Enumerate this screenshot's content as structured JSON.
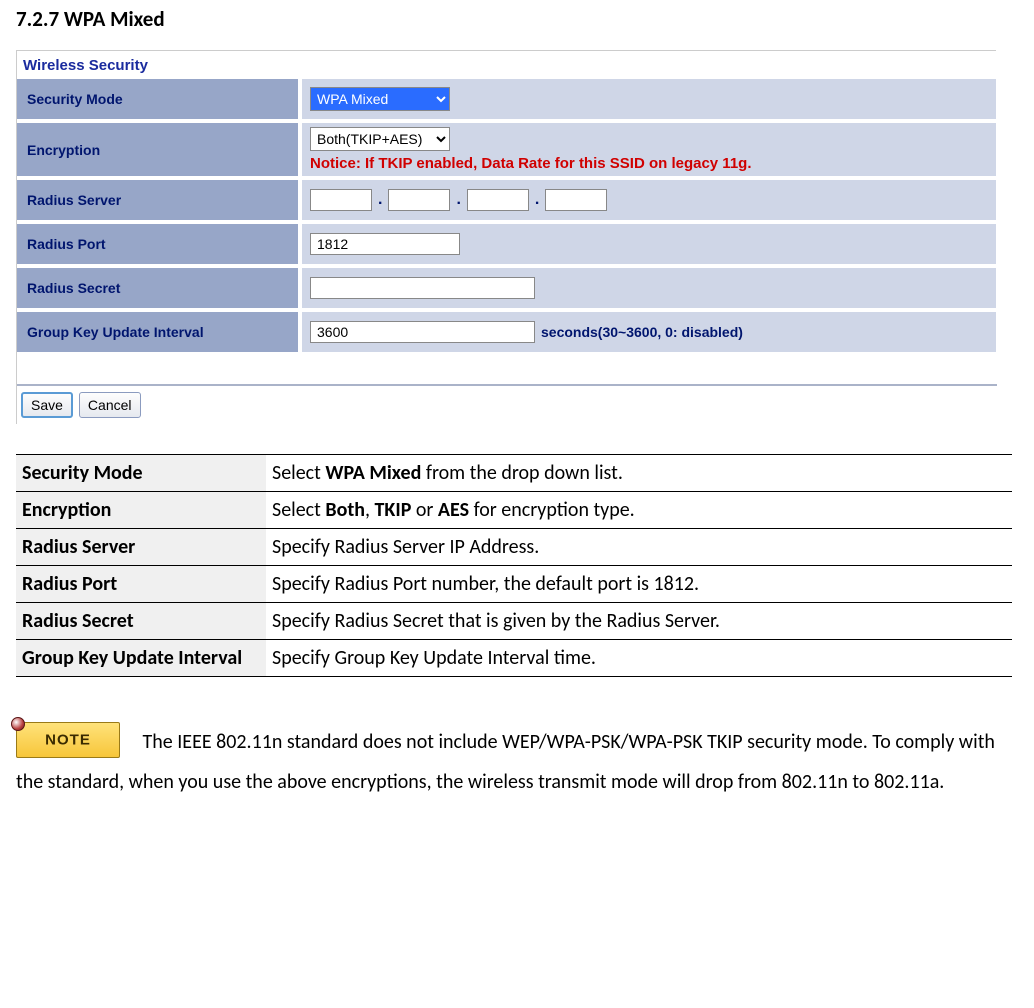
{
  "heading": "7.2.7 WPA Mixed",
  "panel": {
    "title": "Wireless Security",
    "rows": {
      "security_mode": {
        "label": "Security Mode",
        "value": "WPA Mixed"
      },
      "encryption": {
        "label": "Encryption",
        "value": "Both(TKIP+AES)",
        "warning": "Notice: If TKIP enabled, Data Rate for this SSID on legacy 11g."
      },
      "radius_server": {
        "label": "Radius Server",
        "dot": "."
      },
      "radius_port": {
        "label": "Radius Port",
        "value": "1812"
      },
      "radius_secret": {
        "label": "Radius Secret",
        "value": ""
      },
      "group_key": {
        "label": "Group Key Update Interval",
        "value": "3600",
        "suffix": "seconds(30~3600, 0: disabled)"
      }
    },
    "buttons": {
      "save": "Save",
      "cancel": "Cancel"
    }
  },
  "definitions": [
    {
      "term": "Security Mode",
      "desc_pre": "Select ",
      "desc_bold1": "WPA Mixed",
      "desc_mid": " from the drop down list.",
      "desc_bold2": "",
      "desc_mid2": "",
      "desc_bold3": "",
      "desc_end": ""
    },
    {
      "term": "Encryption",
      "desc_pre": "Select ",
      "desc_bold1": "Both",
      "desc_mid": ", ",
      "desc_bold2": "TKIP",
      "desc_mid2": " or ",
      "desc_bold3": "AES",
      "desc_end": " for encryption type."
    },
    {
      "term": "Radius Server",
      "desc_pre": "Specify Radius Server IP Address.",
      "desc_bold1": "",
      "desc_mid": "",
      "desc_bold2": "",
      "desc_mid2": "",
      "desc_bold3": "",
      "desc_end": ""
    },
    {
      "term": "Radius Port",
      "desc_pre": "Specify Radius Port number, the default port is 1812.",
      "desc_bold1": "",
      "desc_mid": "",
      "desc_bold2": "",
      "desc_mid2": "",
      "desc_bold3": "",
      "desc_end": ""
    },
    {
      "term": "Radius Secret",
      "desc_pre": "Specify Radius Secret that is given by the Radius Server.",
      "desc_bold1": "",
      "desc_mid": "",
      "desc_bold2": "",
      "desc_mid2": "",
      "desc_bold3": "",
      "desc_end": ""
    },
    {
      "term": "Group Key Update Interval",
      "desc_pre": "Specify Group Key Update Interval time.",
      "desc_bold1": "",
      "desc_mid": "",
      "desc_bold2": "",
      "desc_mid2": "",
      "desc_bold3": "",
      "desc_end": ""
    }
  ],
  "note": {
    "badge": "NOTE",
    "text": "The IEEE 802.11n standard does not include WEP/WPA-PSK/WPA-PSK TKIP security mode. To comply with the standard, when you use the above encryptions, the wireless transmit mode will drop from 802.11n to 802.11a."
  }
}
